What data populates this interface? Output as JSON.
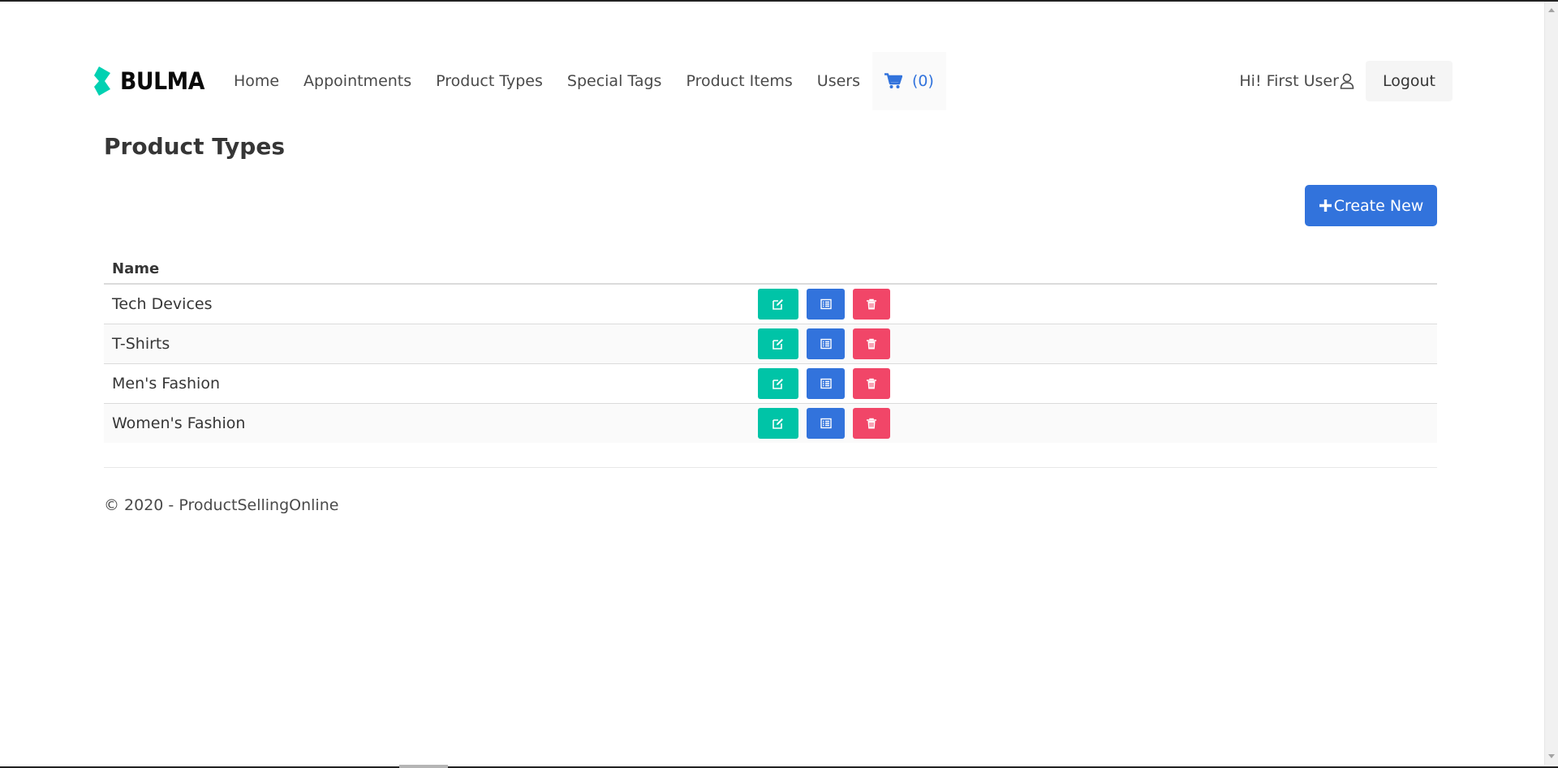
{
  "brand": {
    "name": "BULMA"
  },
  "nav": {
    "items": [
      {
        "label": "Home"
      },
      {
        "label": "Appointments"
      },
      {
        "label": "Product Types"
      },
      {
        "label": "Special Tags"
      },
      {
        "label": "Product Items"
      },
      {
        "label": "Users"
      }
    ],
    "cart": {
      "label": "(0)",
      "icon": "cart-icon"
    }
  },
  "user": {
    "greeting": "Hi! First User",
    "icon": "user-icon",
    "logout_label": "Logout"
  },
  "page": {
    "title": "Product Types",
    "create_label": "Create New"
  },
  "table": {
    "header": "Name",
    "rows": [
      {
        "name": "Tech Devices"
      },
      {
        "name": "T-Shirts"
      },
      {
        "name": "Men's Fashion"
      },
      {
        "name": "Women's Fashion"
      }
    ]
  },
  "footer": {
    "text": "© 2020 - ProductSellingOnline"
  },
  "colors": {
    "primary": "#3273dc",
    "success": "#00c4a7",
    "danger": "#f14668",
    "brand_accent": "#00d1b2"
  }
}
